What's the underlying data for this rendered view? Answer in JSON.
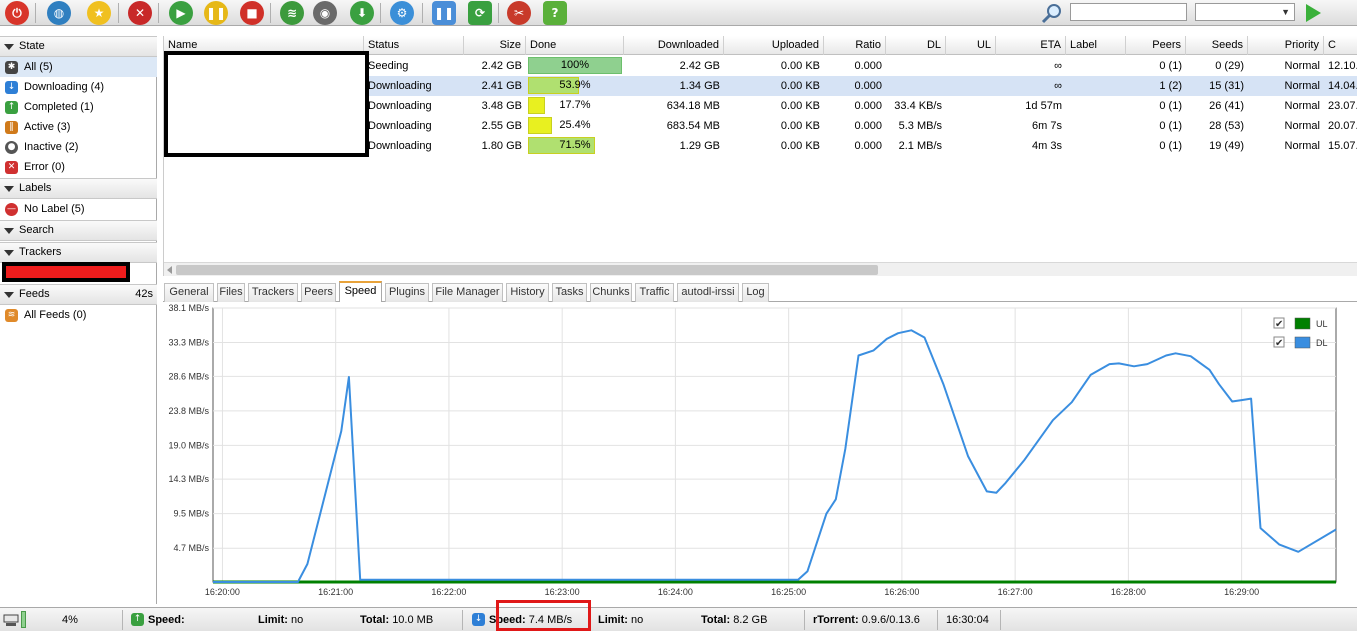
{
  "toolbar": {
    "buttons": [
      {
        "name": "power-icon",
        "color": "#d8352a",
        "glyph": "⏻"
      },
      {
        "name": "globe-icon",
        "color": "#2f7fc0",
        "glyph": "◍"
      },
      {
        "name": "star-icon",
        "color": "#f0c020",
        "glyph": "★"
      },
      {
        "name": "remove-icon",
        "color": "#c82828",
        "glyph": "✕"
      },
      {
        "name": "start-icon",
        "color": "#3aa040",
        "glyph": "▶"
      },
      {
        "name": "pause-icon",
        "color": "#e6b818",
        "glyph": "❚❚"
      },
      {
        "name": "stop-icon",
        "color": "#d03028",
        "glyph": "■"
      },
      {
        "name": "rss-icon",
        "color": "#3c9a3c",
        "glyph": "≋"
      },
      {
        "name": "rtorrent-icon",
        "color": "#6a6a6a",
        "glyph": "◉"
      },
      {
        "name": "download-icon",
        "color": "#3aa040",
        "glyph": "⬇"
      },
      {
        "name": "settings-icon",
        "color": "#3b8fd8",
        "glyph": "⚙"
      },
      {
        "name": "pause-all-icon",
        "color": "#4a8ed8",
        "glyph": "❚❚"
      },
      {
        "name": "refresh-icon",
        "color": "#3aa040",
        "glyph": "⟳"
      },
      {
        "name": "tools-icon",
        "color": "#c83a2a",
        "glyph": "✂"
      },
      {
        "name": "help-icon",
        "color": "#5ab03a",
        "glyph": "?"
      }
    ],
    "search_icon": "magnifier-icon",
    "go_icon": "go-arrow-icon"
  },
  "sidebar": {
    "state_title": "State",
    "states": [
      {
        "label": "All (5)",
        "icon": "all-icon",
        "color": "#444444",
        "glyph": "✱"
      },
      {
        "label": "Downloading (4)",
        "icon": "downloading-icon",
        "color": "#2e7fd6",
        "glyph": "↓"
      },
      {
        "label": "Completed (1)",
        "icon": "completed-icon",
        "color": "#3aa040",
        "glyph": "↑"
      },
      {
        "label": "Active (3)",
        "icon": "active-icon",
        "color": "#d07a1a",
        "glyph": "‖"
      },
      {
        "label": "Inactive (2)",
        "icon": "inactive-icon",
        "color": "#555555",
        "glyph": "●"
      },
      {
        "label": "Error (0)",
        "icon": "error-icon",
        "color": "#d03030",
        "glyph": "✕"
      }
    ],
    "labels_title": "Labels",
    "labels": [
      {
        "label": "No Label (5)",
        "icon": "no-label-icon",
        "color": "#d03030",
        "glyph": "—"
      }
    ],
    "search_title": "Search",
    "trackers_title": "Trackers",
    "feeds_title": "Feeds",
    "feeds_time": "42s",
    "feeds": [
      {
        "label": "All Feeds (0)",
        "icon": "rss-feed-icon",
        "color": "#e08a2a",
        "glyph": "≋"
      }
    ]
  },
  "list": {
    "columns": [
      "Name",
      "Status",
      "Size",
      "Done",
      "Downloaded",
      "Uploaded",
      "Ratio",
      "DL",
      "UL",
      "ETA",
      "Label",
      "Peers",
      "Seeds",
      "Priority",
      "C"
    ],
    "rows": [
      {
        "status": "Seeding",
        "size": "2.42 GB",
        "done": "100%",
        "done_frac": 1.0,
        "downloaded": "2.42 GB",
        "uploaded": "0.00 KB",
        "ratio": "0.000",
        "dl": "",
        "ul": "",
        "eta": "∞",
        "label": "",
        "peers": "0 (1)",
        "seeds": "0 (29)",
        "priority": "Normal",
        "created": "12.10."
      },
      {
        "status": "Downloading",
        "size": "2.41 GB",
        "done": "53.9%",
        "done_frac": 0.539,
        "downloaded": "1.34 GB",
        "uploaded": "0.00 KB",
        "ratio": "0.000",
        "dl": "",
        "ul": "",
        "eta": "∞",
        "label": "",
        "peers": "1 (2)",
        "seeds": "15 (31)",
        "priority": "Normal",
        "created": "14.04."
      },
      {
        "status": "Downloading",
        "size": "3.48 GB",
        "done": "17.7%",
        "done_frac": 0.177,
        "downloaded": "634.18 MB",
        "uploaded": "0.00 KB",
        "ratio": "0.000",
        "dl": "33.4 KB/s",
        "ul": "",
        "eta": "1d 57m",
        "label": "",
        "peers": "0 (1)",
        "seeds": "26 (41)",
        "priority": "Normal",
        "created": "23.07."
      },
      {
        "status": "Downloading",
        "size": "2.55 GB",
        "done": "25.4%",
        "done_frac": 0.254,
        "downloaded": "683.54 MB",
        "uploaded": "0.00 KB",
        "ratio": "0.000",
        "dl": "5.3 MB/s",
        "ul": "",
        "eta": "6m 7s",
        "label": "",
        "peers": "0 (1)",
        "seeds": "28 (53)",
        "priority": "Normal",
        "created": "20.07."
      },
      {
        "status": "Downloading",
        "size": "1.80 GB",
        "done": "71.5%",
        "done_frac": 0.715,
        "downloaded": "1.29 GB",
        "uploaded": "0.00 KB",
        "ratio": "0.000",
        "dl": "2.1 MB/s",
        "ul": "",
        "eta": "4m 3s",
        "label": "",
        "peers": "0 (1)",
        "seeds": "19 (49)",
        "priority": "Normal",
        "created": "15.07."
      }
    ]
  },
  "tabs": [
    "General",
    "Files",
    "Trackers",
    "Peers",
    "Speed",
    "Plugins",
    "File Manager",
    "History",
    "Tasks",
    "Chunks",
    "Traffic",
    "autodl-irssi",
    "Log"
  ],
  "active_tab": "Speed",
  "chart_data": {
    "type": "line",
    "yticks": [
      "38.1 MB/s",
      "33.3 MB/s",
      "28.6 MB/s",
      "23.8 MB/s",
      "19.0 MB/s",
      "14.3 MB/s",
      "9.5 MB/s",
      "4.7 MB/s"
    ],
    "ytick_values": [
      38.1,
      33.3,
      28.6,
      23.8,
      19.0,
      14.3,
      9.5,
      4.7
    ],
    "xticks": [
      "16:20:00",
      "16:21:00",
      "16:22:00",
      "16:23:00",
      "16:24:00",
      "16:25:00",
      "16:26:00",
      "16:27:00",
      "16:28:00",
      "16:29:00"
    ],
    "ylim": [
      0,
      38.1
    ],
    "xlim": [
      "16:19:55",
      "16:29:50"
    ],
    "grid": true,
    "legend_position": "top-right",
    "series": [
      {
        "name": "UL",
        "color": "#008000",
        "checked": true,
        "x": [
          "16:19:55",
          "16:29:50"
        ],
        "values": [
          0,
          0
        ]
      },
      {
        "name": "DL",
        "color": "#3a8ee0",
        "checked": true,
        "x": [
          "16:19:55",
          "16:20:40",
          "16:20:45",
          "16:21:03",
          "16:21:07",
          "16:21:13",
          "16:25:05",
          "16:25:10",
          "16:25:20",
          "16:25:25",
          "16:25:30",
          "16:25:37",
          "16:25:45",
          "16:25:52",
          "16:25:58",
          "16:26:05",
          "16:26:12",
          "16:26:22",
          "16:26:35",
          "16:26:45",
          "16:26:50",
          "16:26:55",
          "16:27:05",
          "16:27:20",
          "16:27:30",
          "16:27:40",
          "16:27:50",
          "16:27:55",
          "16:28:03",
          "16:28:10",
          "16:28:20",
          "16:28:25",
          "16:28:33",
          "16:28:43",
          "16:28:48",
          "16:28:55",
          "16:29:00",
          "16:29:05",
          "16:29:10",
          "16:29:20",
          "16:29:30",
          "16:29:50"
        ],
        "values": [
          0,
          0,
          2.5,
          21,
          28.5,
          0.3,
          0.3,
          1.5,
          9.5,
          11.5,
          18.5,
          31.5,
          32.2,
          33.8,
          34.6,
          35.0,
          34.0,
          27.5,
          17.5,
          12.6,
          12.4,
          13.8,
          17.0,
          22.5,
          25.0,
          28.8,
          30.3,
          30.4,
          30.0,
          30.3,
          31.5,
          31.8,
          31.4,
          29.5,
          27.5,
          25.1,
          25.3,
          25.5,
          7.5,
          5.2,
          4.2,
          7.3
        ]
      }
    ]
  },
  "statusbar": {
    "disk_pct": "4%",
    "dl_speed_label": "Speed:",
    "dl_speed_value": "",
    "dl_limit_label": "Limit:",
    "dl_limit_value": "no",
    "dl_total_label": "Total:",
    "dl_total_value": "10.0 MB",
    "ul_speed_label": "Speed:",
    "ul_speed_value": "7.4 MB/s",
    "ul_limit_label": "Limit:",
    "ul_limit_value": "no",
    "ul_total_label": "Total:",
    "ul_total_value": "8.2 GB",
    "client_label": "rTorrent:",
    "client_version": "0.9.6/0.13.6",
    "clock": "16:30:04"
  }
}
